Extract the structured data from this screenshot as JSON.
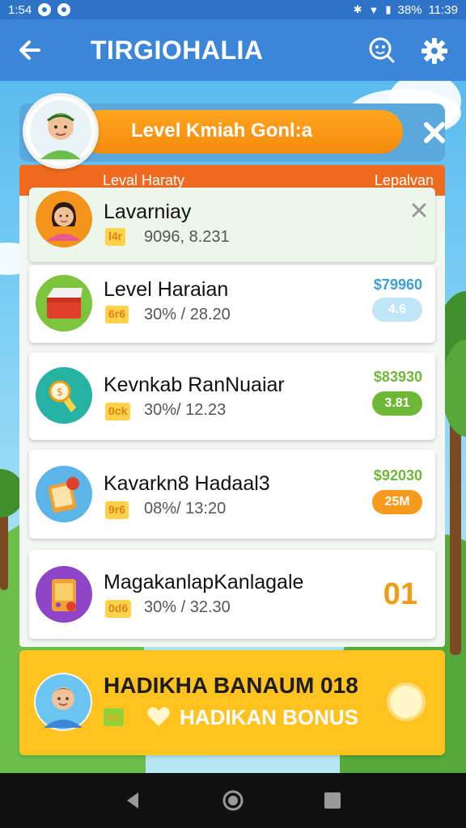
{
  "status_bar": {
    "left_text": "1:54",
    "right_text": "11:39",
    "battery": "38%"
  },
  "app_bar": {
    "title": "TIRGIOHALIA",
    "icons": [
      "back-arrow-icon",
      "face-search-icon",
      "gear-icon"
    ]
  },
  "banner": {
    "title": "Level Kmiah Gonl:a"
  },
  "panel": {
    "header_left": "Leval Haraty",
    "header_right": "Lepalvan"
  },
  "items": [
    {
      "title": "Lavarniay",
      "badge": "l4r",
      "subtitle": "9096, 8.231",
      "icon": "girl-avatar-icon"
    },
    {
      "title": "Level Haraian",
      "badge": "6r6",
      "subtitle": "30% / 28.20",
      "price": "$79960",
      "pill": "4.6",
      "pill_color": "#bfe5f7",
      "price_color": "#3b9fd8",
      "icon": "treasure-chest-icon"
    },
    {
      "title": "Kevnkab RanNuaiar",
      "badge": "0ck",
      "subtitle": "30%/ 12.23",
      "price": "$83930",
      "pill": "3.81",
      "pill_color": "#6fb837",
      "price_color": "#6fb837",
      "icon": "medal-icon"
    },
    {
      "title": "Kavarkn8 Hadaal3",
      "badge": "9r6",
      "subtitle": "08%/ 13:20",
      "price": "$92030",
      "pill": "25M",
      "pill_color": "#f59a1c",
      "price_color": "#6fb837",
      "icon": "gift-card-icon"
    },
    {
      "title": "MagakanlapKanlagale",
      "badge": "0d6",
      "subtitle": "30% / 32.30",
      "big": "01",
      "icon": "game-device-icon"
    }
  ],
  "bonus": {
    "title": "HADIKHA BANAUM 018",
    "badge": "uu",
    "label": "HADIKAN BONUS"
  },
  "colors": {
    "app_bar": "#3b86d8",
    "accent_orange": "#ef6a1e",
    "bonus_yellow": "#ffc21f"
  }
}
